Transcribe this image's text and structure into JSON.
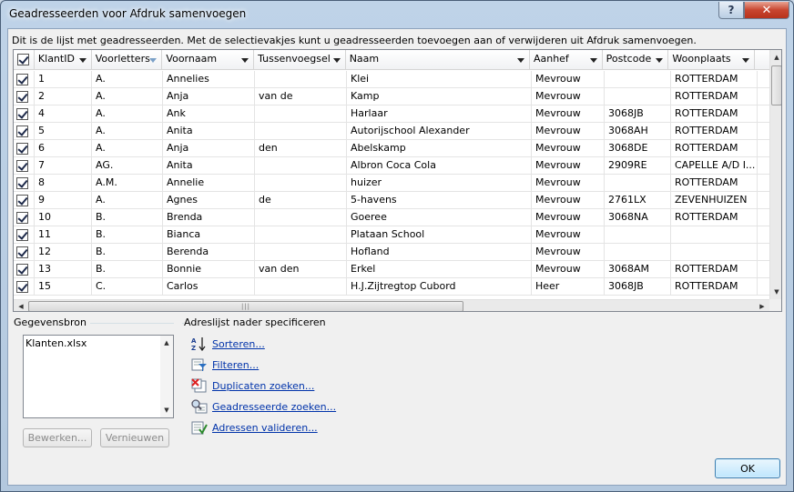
{
  "window": {
    "title": "Geadresseerden voor Afdruk samenvoegen",
    "help": "?",
    "close": "✕"
  },
  "intro_text": "Dit is de lijst met geadresseerden. Met de selectievakjes kunt u geadresseerden toevoegen aan of verwijderen uit Afdruk samenvoegen.",
  "table": {
    "columns": [
      "KlantID",
      "Voorletters",
      "Voornaam",
      "Tussenvoegsel",
      "Naam",
      "Aanhef",
      "Postcode",
      "Woonplaats"
    ],
    "rows": [
      [
        "1",
        "A.",
        "Annelies",
        "",
        "Klei",
        "Mevrouw",
        "",
        "ROTTERDAM"
      ],
      [
        "2",
        "A.",
        "Anja",
        "van de",
        "Kamp",
        "Mevrouw",
        "",
        "ROTTERDAM"
      ],
      [
        "4",
        "A.",
        "Ank",
        "",
        "Harlaar",
        "Mevrouw",
        "3068JB",
        "ROTTERDAM"
      ],
      [
        "5",
        "A.",
        "Anita",
        "",
        "Autorijschool Alexander",
        "Mevrouw",
        "3068AH",
        "ROTTERDAM"
      ],
      [
        "6",
        "A.",
        "Anja",
        "den",
        "Abelskamp",
        "Mevrouw",
        "3068DE",
        "ROTTERDAM"
      ],
      [
        "7",
        "AG.",
        "Anita",
        "",
        "Albron Coca Cola",
        "Mevrouw",
        "2909RE",
        "CAPELLE A/D I..."
      ],
      [
        "8",
        "A.M.",
        "Annelie",
        "",
        "huizer",
        "Mevrouw",
        "",
        "ROTTERDAM"
      ],
      [
        "9",
        "A.",
        "Agnes",
        "de",
        "5-havens",
        "Mevrouw",
        "2761LX",
        "ZEVENHUIZEN"
      ],
      [
        "10",
        "B.",
        "Brenda",
        "",
        "Goeree",
        "Mevrouw",
        "3068NA",
        "ROTTERDAM"
      ],
      [
        "11",
        "B.",
        "Bianca",
        "",
        "Plataan School",
        "Mevrouw",
        "",
        ""
      ],
      [
        "12",
        "B.",
        "Berenda",
        "",
        "Hofland",
        "Mevrouw",
        "",
        ""
      ],
      [
        "13",
        "B.",
        "Bonnie",
        "van den",
        "Erkel",
        "Mevrouw",
        "3068AM",
        "ROTTERDAM"
      ],
      [
        "15",
        "C.",
        "Carlos",
        "",
        "H.J.Zijtregtop Cubord",
        "Heer",
        "3068JB",
        "ROTTERDAM"
      ]
    ]
  },
  "datasource": {
    "label": "Gegevensbron",
    "items": [
      "Klanten.xlsx"
    ],
    "edit_button": "Bewerken...",
    "refresh_button": "Vernieuwen"
  },
  "refine": {
    "label": "Adreslijst nader specificeren",
    "links": [
      "Sorteren...",
      "Filteren...",
      "Duplicaten zoeken...",
      "Geadresseerde zoeken...",
      "Adressen valideren..."
    ]
  },
  "ok_button": "OK"
}
